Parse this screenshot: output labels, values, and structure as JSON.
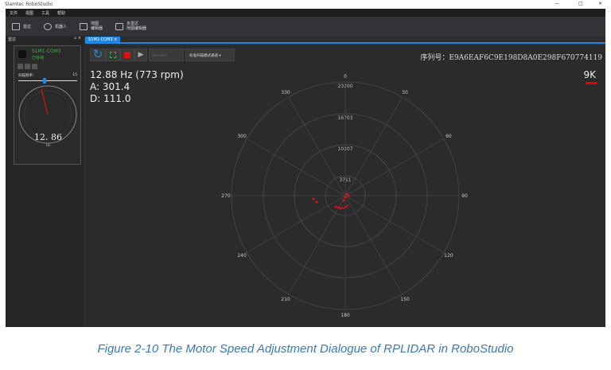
{
  "window": {
    "title": "Slamtec RoboStudio",
    "controls": [
      "—",
      "□",
      "✕"
    ]
  },
  "menu": [
    "文件",
    "视图",
    "工具",
    "帮助"
  ],
  "toolbar": [
    {
      "label": "雷达",
      "icon": "lidar-icon"
    },
    {
      "label": "机器人",
      "icon": "robot-icon"
    },
    {
      "label": "地图\n编辑器",
      "icon": "map-editor-icon"
    },
    {
      "label": "多雷达\n地图编辑器",
      "icon": "multi-lidar-icon"
    }
  ],
  "left_panel": {
    "title": "雷达",
    "device": {
      "name": "S1M1-COM3",
      "status": "已就绪"
    },
    "scan_freq_label": "扫描频率：",
    "scan_freq_value": "15",
    "slider_fraction": 0.45,
    "gauge_value": "12. 86",
    "gauge_unit": "Hz"
  },
  "tab": {
    "label": "S1M1-COM3 ×"
  },
  "controls": {
    "mode_placeholder": "Standard",
    "scan_mode": "标准扫描模式通道"
  },
  "readout": {
    "freq": "12.88 Hz (773 rpm)",
    "angle": "A: 301.4",
    "distance": "D: 111.0"
  },
  "serial": "序列号：E9A6EAF6C9E198D8A0E298F670774119",
  "scale": "9K",
  "polar": {
    "rings": [
      "3711",
      "10207",
      "16703",
      "23200"
    ],
    "angles": [
      "0",
      "30",
      "60",
      "90",
      "120",
      "150",
      "180",
      "210",
      "240",
      "270",
      "300",
      "330"
    ]
  },
  "caption": "Figure 2-10 The Motor Speed Adjustment Dialogue of RPLIDAR in RoboStudio",
  "colors": {
    "accent": "#1e88e5",
    "point": "#e01010",
    "status_green": "#3cb043"
  }
}
